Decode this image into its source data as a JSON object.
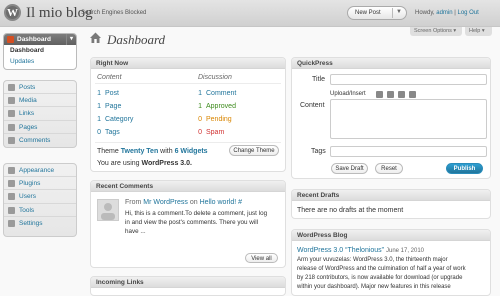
{
  "header": {
    "site_title": "Il mio blog",
    "site_description": "Search Engines Blocked",
    "new_post": "New Post",
    "howdy_prefix": "Howdy,",
    "username": "admin",
    "separator": "|",
    "logout": "Log Out"
  },
  "screen_tabs": {
    "screen_options": "Screen Options ▾",
    "help": "Help ▾"
  },
  "page_title": "Dashboard",
  "sidebar": {
    "dashboard": {
      "label": "Dashboard",
      "submenu": [
        "Dashboard",
        "Updates"
      ]
    },
    "group1": [
      {
        "label": "Posts",
        "icon": "pin-icon"
      },
      {
        "label": "Media",
        "icon": "media-icon"
      },
      {
        "label": "Links",
        "icon": "links-icon"
      },
      {
        "label": "Pages",
        "icon": "pages-icon"
      },
      {
        "label": "Comments",
        "icon": "comments-icon"
      }
    ],
    "group2": [
      {
        "label": "Appearance",
        "icon": "appearance-icon"
      },
      {
        "label": "Plugins",
        "icon": "plugins-icon"
      },
      {
        "label": "Users",
        "icon": "users-icon"
      },
      {
        "label": "Tools",
        "icon": "tools-icon"
      },
      {
        "label": "Settings",
        "icon": "settings-icon"
      }
    ]
  },
  "right_now": {
    "title": "Right Now",
    "content_header": "Content",
    "discussion_header": "Discussion",
    "content": [
      {
        "count": "1",
        "label": "Post"
      },
      {
        "count": "1",
        "label": "Page"
      },
      {
        "count": "1",
        "label": "Category"
      },
      {
        "count": "0",
        "label": "Tags"
      }
    ],
    "discussion": [
      {
        "count": "1",
        "label": "Comment"
      },
      {
        "count": "1",
        "label": "Approved"
      },
      {
        "count": "0",
        "label": "Pending"
      },
      {
        "count": "0",
        "label": "Spam"
      }
    ],
    "theme_prefix": "Theme",
    "theme_name": "Twenty Ten",
    "theme_with": "with",
    "widgets": "6 Widgets",
    "change_theme": "Change Theme",
    "version_prefix": "You are using",
    "version": "WordPress 3.0."
  },
  "recent_comments": {
    "title": "Recent Comments",
    "from": "From",
    "author": "Mr WordPress",
    "on": "on",
    "post": "Hello world!",
    "hash": "#",
    "text_lines": [
      "Hi, this is a comment.To delete a comment, just log",
      "in and view the post's comments. There you will",
      "have ..."
    ],
    "view_all": "View all"
  },
  "incoming_links": {
    "title": "Incoming Links"
  },
  "quickpress": {
    "title": "QuickPress",
    "title_label": "Title",
    "upload_label": "Upload/Insert",
    "content_label": "Content",
    "tags_label": "Tags",
    "save_draft": "Save Draft",
    "reset": "Reset",
    "publish": "Publish"
  },
  "recent_drafts": {
    "title": "Recent Drafts",
    "empty": "There are no drafts at the moment"
  },
  "wp_blog": {
    "title": "WordPress Blog",
    "post_title": "WordPress 3.0 “Thelonious”",
    "date": "June 17, 2010",
    "text_lines": [
      "Arm your vuvuzelas: WordPress 3.0, the thirteenth major",
      "release of WordPress and the culmination of half a year of work",
      "by 218 contributors, is now available for download (or upgrade",
      "within your dashboard). Major new features in this release"
    ]
  },
  "colors": {
    "link": "#21759b",
    "approved": "#3d8b1d",
    "pending": "#d98500",
    "spam": "#d03232",
    "accent": "#d54e21"
  }
}
